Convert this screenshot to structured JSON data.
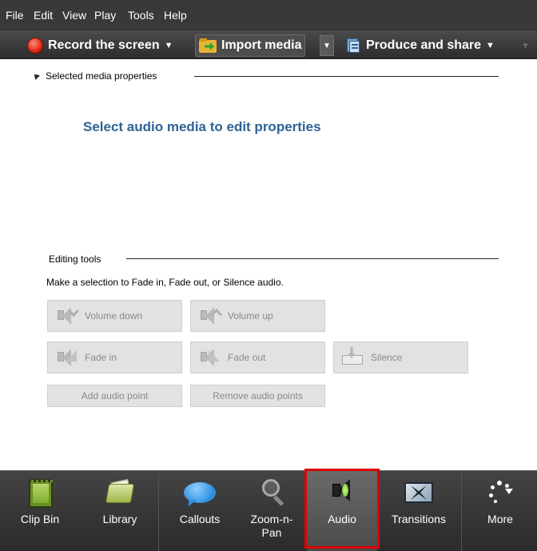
{
  "menu": [
    "File",
    "Edit",
    "View",
    "Play",
    "Tools",
    "Help"
  ],
  "toolbar": {
    "record_label": "Record the screen",
    "import_label": "Import media",
    "produce_label": "Produce and share"
  },
  "properties": {
    "section_title": "Selected media properties",
    "message": "Select audio media to edit properties"
  },
  "editing": {
    "section_title": "Editing tools",
    "hint": "Make a selection to Fade in, Fade out, or Silence audio.",
    "volume_down": "Volume down",
    "volume_up": "Volume up",
    "fade_in": "Fade in",
    "fade_out": "Fade out",
    "silence": "Silence",
    "add_audio_point": "Add audio point",
    "remove_audio_points": "Remove audio points"
  },
  "tabs": [
    {
      "label": "Clip Bin",
      "icon": "film-clip-icon"
    },
    {
      "label": "Library",
      "icon": "library-folder-icon"
    },
    {
      "label": "Callouts",
      "icon": "speech-bubble-icon"
    },
    {
      "label": "Zoom-n-Pan",
      "icon": "magnifier-icon"
    },
    {
      "label": "Audio",
      "icon": "speaker-icon",
      "selected": true
    },
    {
      "label": "Transitions",
      "icon": "transitions-icon"
    },
    {
      "label": "More",
      "icon": "more-dots-icon"
    }
  ],
  "colors": {
    "accent_text": "#2e6496",
    "highlight": "#e00000",
    "record": "#e02a12"
  }
}
